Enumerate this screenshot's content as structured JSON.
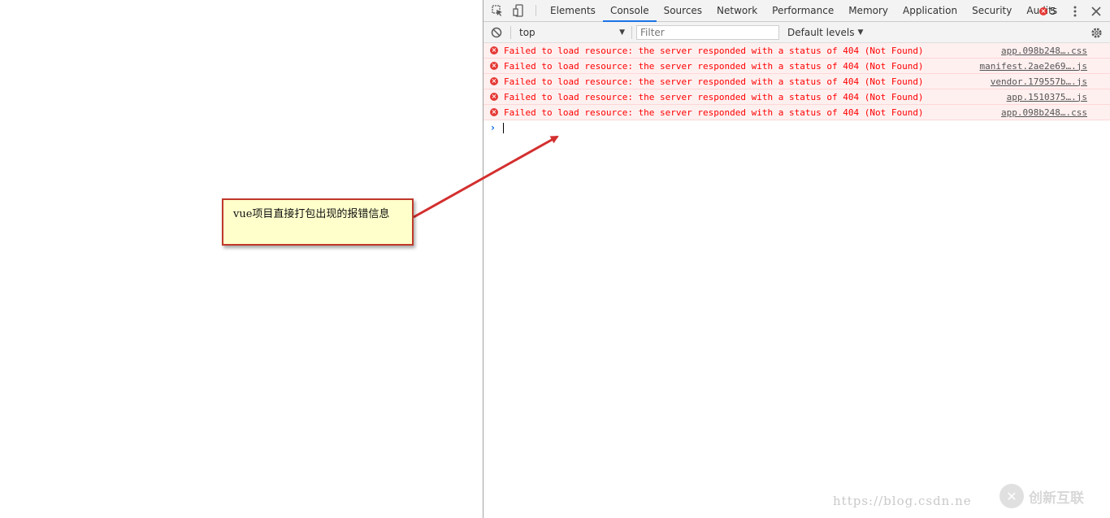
{
  "devtools": {
    "tabs": [
      {
        "label": "Elements"
      },
      {
        "label": "Console"
      },
      {
        "label": "Sources"
      },
      {
        "label": "Network"
      },
      {
        "label": "Performance"
      },
      {
        "label": "Memory"
      },
      {
        "label": "Application"
      },
      {
        "label": "Security"
      },
      {
        "label": "Audits"
      }
    ],
    "active_tab": "Console",
    "error_count": "5",
    "icons": [
      "inspect-element-icon",
      "device-toolbar-icon",
      "error-icon",
      "kebab-menu-icon",
      "close-icon"
    ]
  },
  "console": {
    "context": "top",
    "filter_placeholder": "Filter",
    "levels_label": "Default levels",
    "messages": [
      {
        "text": "Failed to load resource: the server responded with a status of 404 (Not Found)",
        "source": "app.098b248….css"
      },
      {
        "text": "Failed to load resource: the server responded with a status of 404 (Not Found)",
        "source": "manifest.2ae2e69….js"
      },
      {
        "text": "Failed to load resource: the server responded with a status of 404 (Not Found)",
        "source": "vendor.179557b….js"
      },
      {
        "text": "Failed to load resource: the server responded with a status of 404 (Not Found)",
        "source": "app.1510375….js"
      },
      {
        "text": "Failed to load resource: the server responded with a status of 404 (Not Found)",
        "source": "app.098b248….css"
      }
    ],
    "prompt_symbol": "›",
    "colors": {
      "error_text": "#ff0000",
      "error_bg": "#fff0f0",
      "accent": "#1a73e8"
    }
  },
  "annotation": {
    "text": "vue项目直接打包出现的报错信息",
    "colors": {
      "background": "#ffffcc",
      "border": "#c0392b",
      "arrow": "#d32f2f"
    }
  },
  "watermark": {
    "url": "https://blog.csdn.ne",
    "brand": "创新互联"
  }
}
